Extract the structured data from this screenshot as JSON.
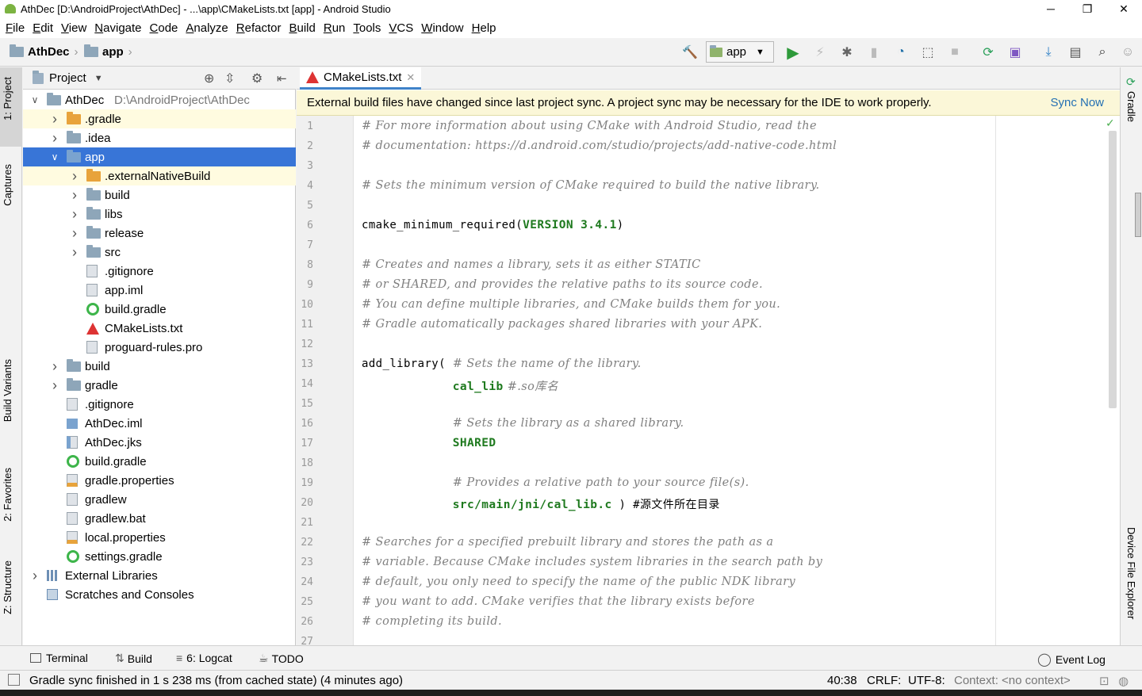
{
  "window": {
    "title": "AthDec [D:\\AndroidProject\\AthDec] - ...\\app\\CMakeLists.txt [app] - Android Studio",
    "minimize": "─",
    "restore": "❐",
    "close": "✕"
  },
  "menu": [
    "File",
    "Edit",
    "View",
    "Navigate",
    "Code",
    "Analyze",
    "Refactor",
    "Build",
    "Run",
    "Tools",
    "VCS",
    "Window",
    "Help"
  ],
  "breadcrumb": {
    "project": "AthDec",
    "module": "app"
  },
  "toolbar": {
    "run_config": "app"
  },
  "left_tabs": {
    "project": "1: Project",
    "captures": "Captures",
    "build_variants": "Build Variants",
    "favorites": "2: Favorites",
    "structure": "Z: Structure"
  },
  "right_tabs": {
    "gradle": "Gradle",
    "device_explorer": "Device File Explorer"
  },
  "project_panel": {
    "title": "Project",
    "tree": [
      {
        "label": "AthDec",
        "path": "D:\\AndroidProject\\AthDec",
        "depth": 0,
        "arrow": "down",
        "icon": "module"
      },
      {
        "label": ".gradle",
        "depth": 1,
        "arrow": "right",
        "icon": "folder-orange",
        "state": "highlight"
      },
      {
        "label": ".idea",
        "depth": 1,
        "arrow": "right",
        "icon": "folder"
      },
      {
        "label": "app",
        "depth": 1,
        "arrow": "down",
        "icon": "folder-module",
        "state": "selected"
      },
      {
        "label": ".externalNativeBuild",
        "depth": 2,
        "arrow": "right",
        "icon": "folder-orange",
        "state": "highlight"
      },
      {
        "label": "build",
        "depth": 2,
        "arrow": "right",
        "icon": "folder"
      },
      {
        "label": "libs",
        "depth": 2,
        "arrow": "right",
        "icon": "folder"
      },
      {
        "label": "release",
        "depth": 2,
        "arrow": "right",
        "icon": "folder"
      },
      {
        "label": "src",
        "depth": 2,
        "arrow": "right",
        "icon": "folder"
      },
      {
        "label": ".gitignore",
        "depth": 2,
        "icon": "file"
      },
      {
        "label": "app.iml",
        "depth": 2,
        "icon": "file"
      },
      {
        "label": "build.gradle",
        "depth": 2,
        "icon": "gradle"
      },
      {
        "label": "CMakeLists.txt",
        "depth": 2,
        "icon": "cmake"
      },
      {
        "label": "proguard-rules.pro",
        "depth": 2,
        "icon": "file"
      },
      {
        "label": "build",
        "depth": 1,
        "arrow": "right",
        "icon": "folder"
      },
      {
        "label": "gradle",
        "depth": 1,
        "arrow": "right",
        "icon": "folder"
      },
      {
        "label": ".gitignore",
        "depth": 1,
        "icon": "file"
      },
      {
        "label": "AthDec.iml",
        "depth": 1,
        "icon": "iml"
      },
      {
        "label": "AthDec.jks",
        "depth": 1,
        "icon": "jks"
      },
      {
        "label": "build.gradle",
        "depth": 1,
        "icon": "gradle"
      },
      {
        "label": "gradle.properties",
        "depth": 1,
        "icon": "props"
      },
      {
        "label": "gradlew",
        "depth": 1,
        "icon": "file"
      },
      {
        "label": "gradlew.bat",
        "depth": 1,
        "icon": "file"
      },
      {
        "label": "local.properties",
        "depth": 1,
        "icon": "props"
      },
      {
        "label": "settings.gradle",
        "depth": 1,
        "icon": "gradle"
      },
      {
        "label": "External Libraries",
        "depth": 0,
        "arrow": "right",
        "icon": "lib"
      },
      {
        "label": "Scratches and Consoles",
        "depth": 0,
        "icon": "scratch"
      }
    ]
  },
  "editor": {
    "tab": "CMakeLists.txt",
    "banner": "External build files have changed since last project sync. A project sync may be necessary for the IDE to work properly.",
    "banner_action": "Sync Now",
    "lines": [
      [
        {
          "t": "# For more information about using CMake with Android Studio, read the",
          "c": "cmt"
        }
      ],
      [
        {
          "t": "# documentation: https://d.android.com/studio/projects/add-native-code.html",
          "c": "cmt"
        }
      ],
      [],
      [
        {
          "t": "# Sets the minimum version of CMake required to build the native library.",
          "c": "cmt"
        }
      ],
      [],
      [
        {
          "t": "cmake_minimum_required(",
          "c": "plain"
        },
        {
          "t": "VERSION 3.4.1",
          "c": "kw"
        },
        {
          "t": ")",
          "c": "plain"
        }
      ],
      [],
      [
        {
          "t": "# Creates and names a library, sets it as either STATIC",
          "c": "cmt"
        }
      ],
      [
        {
          "t": "# or SHARED, and provides the relative paths to its source code.",
          "c": "cmt"
        }
      ],
      [
        {
          "t": "# You can define multiple libraries, and CMake builds them for you.",
          "c": "cmt"
        }
      ],
      [
        {
          "t": "# Gradle automatically packages shared libraries with your APK.",
          "c": "cmt"
        }
      ],
      [],
      [
        {
          "t": "add_library( ",
          "c": "plain"
        },
        {
          "t": "# Sets the name of the library.",
          "c": "cmt"
        }
      ],
      [
        {
          "t": "             ",
          "c": "plain"
        },
        {
          "t": "cal_lib",
          "c": "kw"
        },
        {
          "t": " #.so库名",
          "c": "cmt"
        }
      ],
      [],
      [
        {
          "t": "             ",
          "c": "plain"
        },
        {
          "t": "# Sets the library as a shared library.",
          "c": "cmt"
        }
      ],
      [
        {
          "t": "             ",
          "c": "plain"
        },
        {
          "t": "SHARED",
          "c": "kw"
        }
      ],
      [],
      [
        {
          "t": "             ",
          "c": "plain"
        },
        {
          "t": "# Provides a relative path to your source file(s).",
          "c": "cmt"
        }
      ],
      [
        {
          "t": "             ",
          "c": "plain"
        },
        {
          "t": "src/main/jni/cal_lib.c",
          "c": "kw"
        },
        {
          "t": " ) #源文件所在目录",
          "c": "plain"
        }
      ],
      [],
      [
        {
          "t": "# Searches for a specified prebuilt library and stores the path as a",
          "c": "cmt"
        }
      ],
      [
        {
          "t": "# variable. Because CMake includes system libraries in the search path by",
          "c": "cmt"
        }
      ],
      [
        {
          "t": "# default, you only need to specify the name of the public NDK library",
          "c": "cmt"
        }
      ],
      [
        {
          "t": "# you want to add. CMake verifies that the library exists before",
          "c": "cmt"
        }
      ],
      [
        {
          "t": "# completing its build.",
          "c": "cmt"
        }
      ],
      []
    ],
    "line_numbers": [
      "1",
      "2",
      "3",
      "4",
      "5",
      "6",
      "7",
      "8",
      "9",
      "10",
      "11",
      "12",
      "13",
      "14",
      "15",
      "16",
      "17",
      "18",
      "19",
      "20",
      "21",
      "22",
      "23",
      "24",
      "25",
      "26",
      "27"
    ]
  },
  "bottom_tabs": {
    "terminal": "Terminal",
    "build": "Build",
    "logcat": "6: Logcat",
    "todo": "TODO",
    "event_log": "Event Log"
  },
  "status": {
    "message": "Gradle sync finished in 1 s 238 ms (from cached state) (4 minutes ago)",
    "position": "40:38",
    "line_sep": "CRLF:",
    "encoding": "UTF-8:",
    "context": "Context: <no context>"
  },
  "colors": {
    "selection": "#3875d7",
    "highlight": "#fffbe0",
    "banner": "#fbf7d8",
    "link": "#2470b3",
    "keyword": "#1f7a1f",
    "comment": "#808080"
  }
}
